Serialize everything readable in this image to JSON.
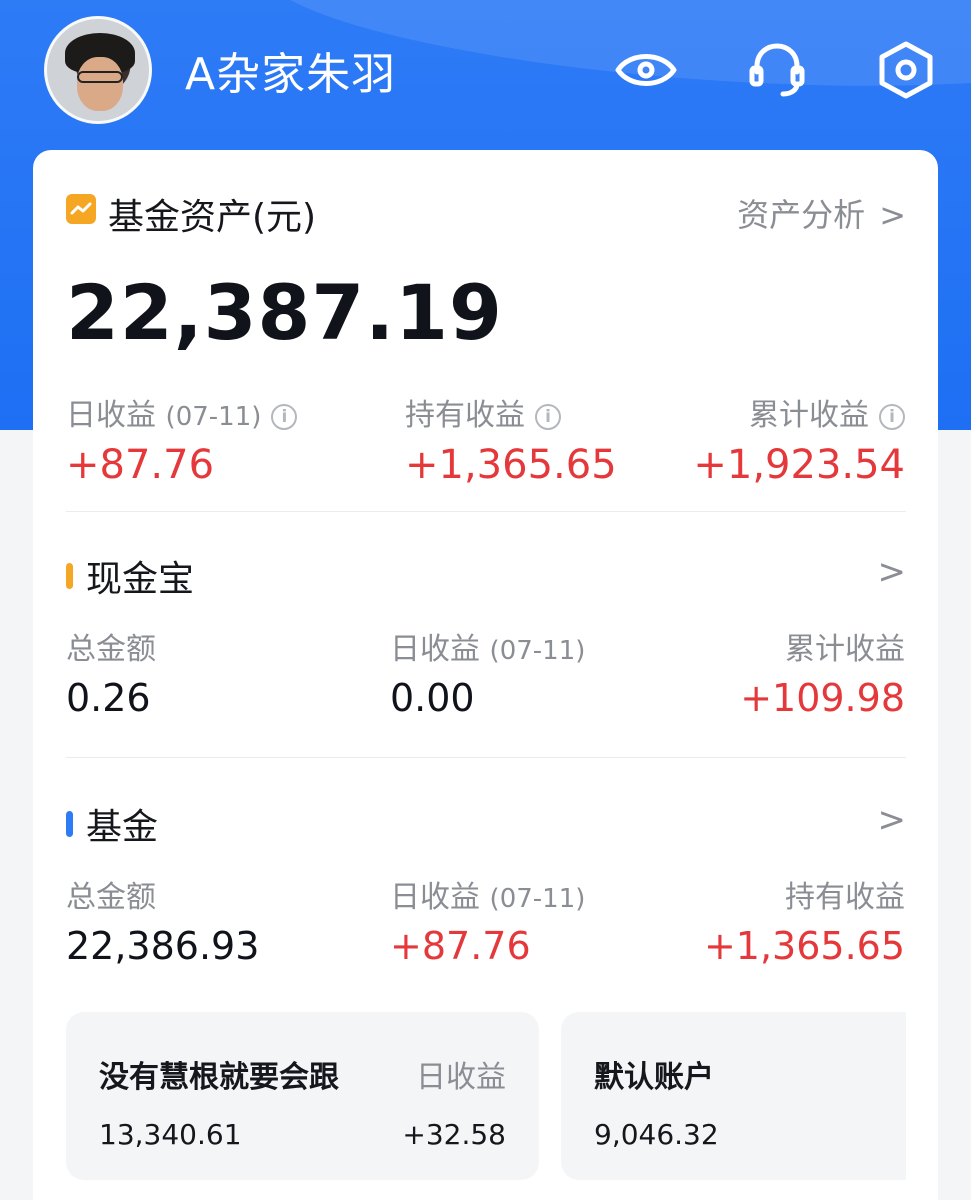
{
  "profile": {
    "username": "A杂家朱羽"
  },
  "header_icons": [
    "eye-icon",
    "headset-icon",
    "settings-icon"
  ],
  "assets": {
    "title": "基金资产(元)",
    "analysis_label": "资产分析",
    "total": "22,387.19",
    "daily_label": "日收益",
    "daily_date": "(07-11)",
    "daily_value": "+87.76",
    "holding_label": "持有收益",
    "holding_value": "+1,365.65",
    "cumulative_label": "累计收益",
    "cumulative_value": "+1,923.54"
  },
  "cash": {
    "title": "现金宝",
    "total_label": "总金额",
    "total_value": "0.26",
    "daily_label": "日收益",
    "daily_date": "(07-11)",
    "daily_value": "0.00",
    "cumulative_label": "累计收益",
    "cumulative_value": "+109.98"
  },
  "fund": {
    "title": "基金",
    "total_label": "总金额",
    "total_value": "22,386.93",
    "daily_label": "日收益",
    "daily_date": "(07-11)",
    "daily_value": "+87.76",
    "holding_label": "持有收益",
    "holding_value": "+1,365.65"
  },
  "accounts": [
    {
      "name": "没有慧根就要会跟",
      "amount": "13,340.61",
      "daily_label": "日收益",
      "daily_value": "+32.58"
    },
    {
      "name": "默认账户",
      "amount": "9,046.32"
    }
  ],
  "colors": {
    "brand_blue": "#1e6ff4",
    "gain_red": "#e5383b",
    "cash_accent": "#f5a623",
    "fund_accent": "#2e7bf6"
  }
}
